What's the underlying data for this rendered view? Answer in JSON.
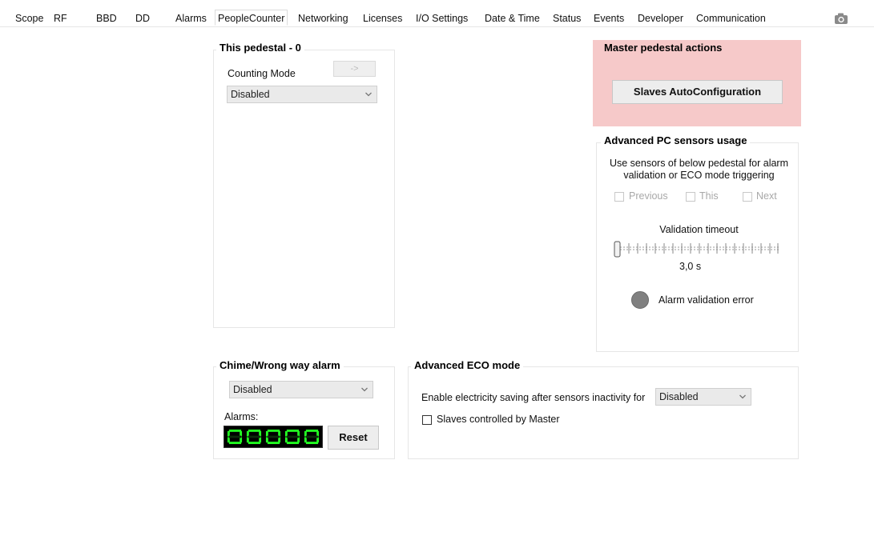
{
  "tabs": [
    {
      "label": "Scope",
      "active": false
    },
    {
      "label": "RF",
      "active": false
    },
    {
      "label": "BBD",
      "active": false
    },
    {
      "label": "DD",
      "active": false
    },
    {
      "label": "Alarms",
      "active": false
    },
    {
      "label": "PeopleCounter",
      "active": true
    },
    {
      "label": "Networking",
      "active": false
    },
    {
      "label": "Licenses",
      "active": false
    },
    {
      "label": "I/O Settings",
      "active": false
    },
    {
      "label": "Date & Time",
      "active": false
    },
    {
      "label": "Status",
      "active": false
    },
    {
      "label": "Events",
      "active": false
    },
    {
      "label": "Developer",
      "active": false
    },
    {
      "label": "Communication",
      "active": false
    }
  ],
  "toolbar": {
    "camera_icon": "camera-icon"
  },
  "this_pedestal": {
    "title": "This pedestal - 0",
    "arrow_button": "->",
    "counting_mode_label": "Counting Mode",
    "counting_mode_value": "Disabled"
  },
  "master": {
    "title": "Master pedestal actions",
    "autoconfig_button": "Slaves AutoConfiguration",
    "bg_color": "#f6c9c9"
  },
  "advanced_pc": {
    "title": "Advanced PC sensors usage",
    "description": "Use sensors of below pedestal for alarm validation or ECO mode triggering",
    "checkboxes": [
      {
        "label": "Previous",
        "checked": false,
        "enabled": false
      },
      {
        "label": "This",
        "checked": false,
        "enabled": false
      },
      {
        "label": "Next",
        "checked": false,
        "enabled": false
      }
    ],
    "timeout_label": "Validation timeout",
    "timeout_value": "3,0 s",
    "slider_level": 0,
    "alarm_indicator_label": "Alarm validation error",
    "indicator_color": "#808080"
  },
  "chime": {
    "title": "Chime/Wrong way alarm",
    "mode_value": "Disabled",
    "alarms_label": "Alarms:",
    "counter": "00000",
    "led_color": "#22ff22",
    "reset_button": "Reset"
  },
  "eco": {
    "title": "Advanced ECO mode",
    "saving_label": "Enable electricity saving after sensors inactivity for",
    "saving_value": "Disabled",
    "slaves_label": "Slaves controlled by Master",
    "slaves_checked": false
  }
}
